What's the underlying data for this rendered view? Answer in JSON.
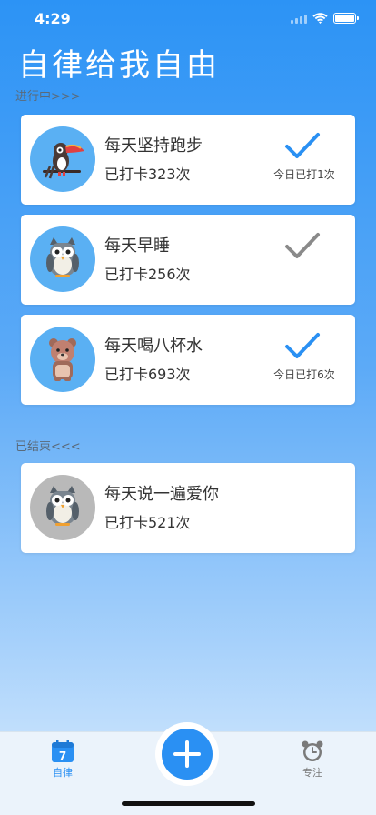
{
  "status": {
    "time": "4:29"
  },
  "app_title": "自律给我自由",
  "sections": {
    "active": "进行中>>>",
    "ended": "已结束<<<"
  },
  "active_habits": [
    {
      "title": "每天坚持跑步",
      "count": "已打卡323次",
      "today": "今日已打1次",
      "avatar": "toucan-icon",
      "checked_today": true
    },
    {
      "title": "每天早睡",
      "count": "已打卡256次",
      "today": "",
      "avatar": "owl-icon",
      "checked_today": false
    },
    {
      "title": "每天喝八杯水",
      "count": "已打卡693次",
      "today": "今日已打6次",
      "avatar": "bear-icon",
      "checked_today": true
    }
  ],
  "ended_habits": [
    {
      "title": "每天说一遍爱你",
      "count": "已打卡521次",
      "avatar": "owl-icon"
    }
  ],
  "tabs": [
    {
      "label": "自律",
      "icon": "calendar-icon",
      "icon_text": "7",
      "active": true
    },
    {
      "label": "专注",
      "icon": "alarm-clock-icon",
      "active": false
    }
  ],
  "colors": {
    "accent": "#2a90f3",
    "check_active": "#2a90f3",
    "check_inactive": "#8a8a8a",
    "tab_inactive": "#7a7a7a"
  }
}
